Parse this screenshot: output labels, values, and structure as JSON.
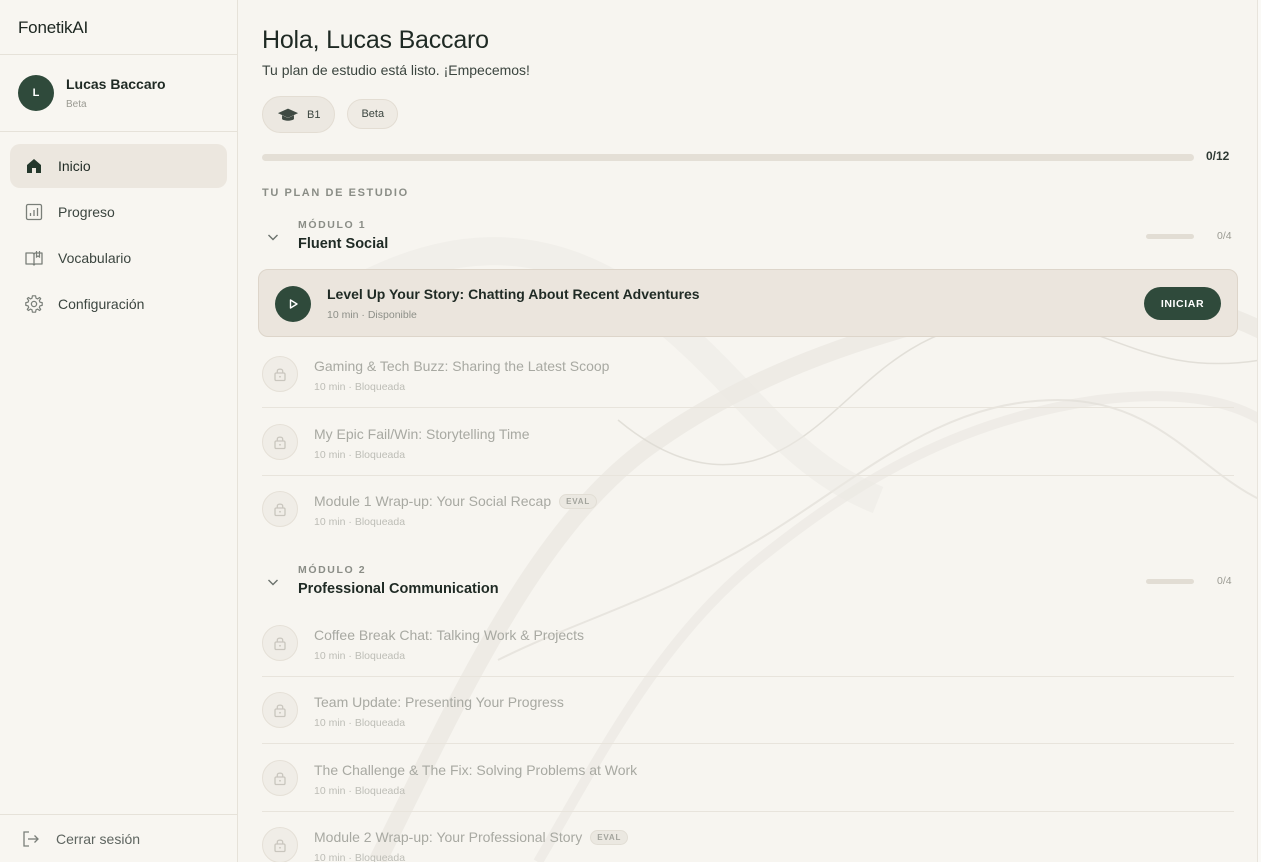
{
  "app": {
    "name": "FonetikAI"
  },
  "user": {
    "initial": "L",
    "name": "Lucas Baccaro",
    "plan": "Beta"
  },
  "nav": {
    "items": [
      {
        "label": "Inicio",
        "icon": "home-icon",
        "active": true
      },
      {
        "label": "Progreso",
        "icon": "chart-icon",
        "active": false
      },
      {
        "label": "Vocabulario",
        "icon": "book-icon",
        "active": false
      },
      {
        "label": "Configuración",
        "icon": "gear-icon",
        "active": false
      }
    ],
    "logout_label": "Cerrar sesión"
  },
  "header": {
    "greeting": "Hola, Lucas Baccaro",
    "subtitle": "Tu plan de estudio está listo. ¡Empecemos!",
    "level_badge": "B1",
    "plan_badge": "Beta",
    "progress": {
      "completed": 0,
      "total": 12,
      "label": "0/12"
    }
  },
  "plan": {
    "section_title": "TU PLAN DE ESTUDIO",
    "modules": [
      {
        "label": "MÓDULO 1",
        "name": "Fluent Social",
        "progress_label": "0/4",
        "progress": 0,
        "lessons": [
          {
            "title": "Level Up Your Story: Chatting About Recent Adventures",
            "meta": "10 min · Disponible",
            "state": "available",
            "action": "INICIAR"
          },
          {
            "title": "Gaming & Tech Buzz: Sharing the Latest Scoop",
            "meta": "10 min · Bloqueada",
            "state": "locked"
          },
          {
            "title": "My Epic Fail/Win: Storytelling Time",
            "meta": "10 min · Bloqueada",
            "state": "locked"
          },
          {
            "title": "Module 1 Wrap-up: Your Social Recap",
            "meta": "10 min · Bloqueada",
            "state": "locked",
            "tag": "EVAL"
          }
        ]
      },
      {
        "label": "MÓDULO 2",
        "name": "Professional Communication",
        "progress_label": "0/4",
        "progress": 0,
        "lessons": [
          {
            "title": "Coffee Break Chat: Talking Work & Projects",
            "meta": "10 min · Bloqueada",
            "state": "locked"
          },
          {
            "title": "Team Update: Presenting Your Progress",
            "meta": "10 min · Bloqueada",
            "state": "locked"
          },
          {
            "title": "The Challenge & The Fix: Solving Problems at Work",
            "meta": "10 min · Bloqueada",
            "state": "locked"
          },
          {
            "title": "Module 2 Wrap-up: Your Professional Story",
            "meta": "10 min · Bloqueada",
            "state": "locked",
            "tag": "EVAL"
          }
        ]
      }
    ]
  },
  "colors": {
    "accent": "#2f4a3b",
    "background": "#f7f5f0",
    "active_row": "#ebe5dd",
    "muted_text": "#a8a9a2"
  }
}
